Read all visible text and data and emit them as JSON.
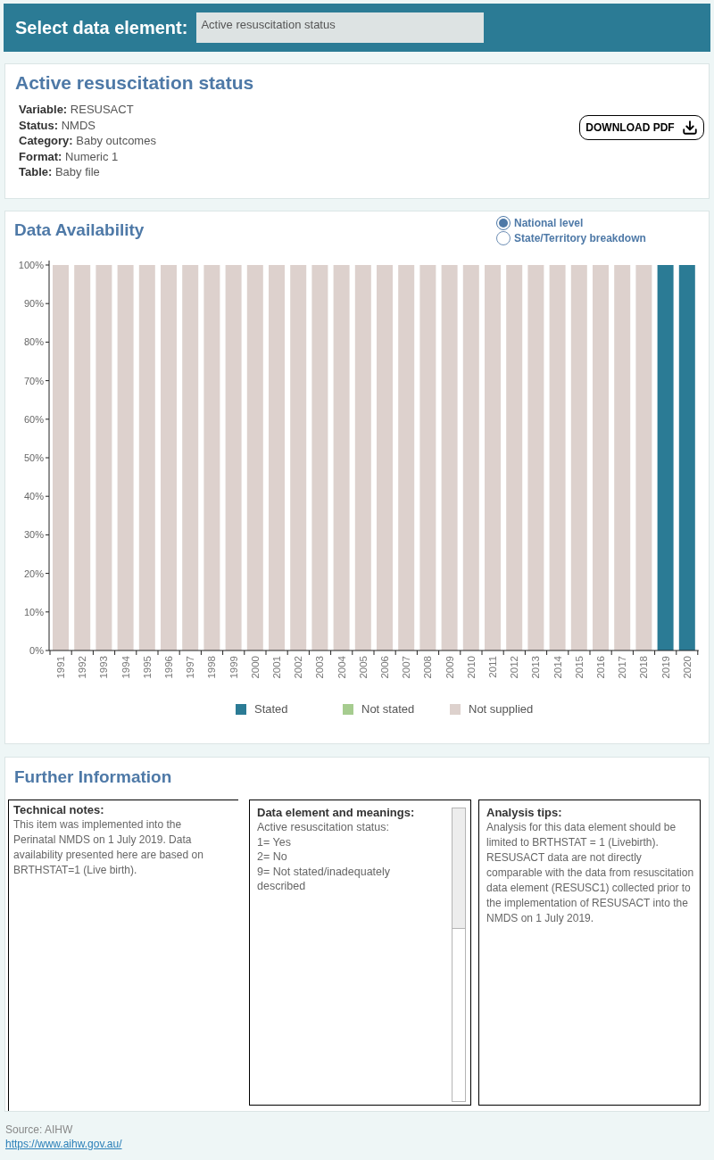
{
  "header": {
    "label": "Select data element:",
    "dropdown": {
      "value": "Active resuscitation status"
    }
  },
  "element": {
    "title": "Active resuscitation status",
    "fields": [
      {
        "label": "Variable:",
        "value": "RESUSACT"
      },
      {
        "label": "Status:",
        "value": "NMDS"
      },
      {
        "label": "Category:",
        "value": "Baby outcomes"
      },
      {
        "label": "Format:",
        "value": "Numeric 1"
      },
      {
        "label": "Table:",
        "value": "Baby file"
      }
    ],
    "download_button": "DOWNLOAD PDF"
  },
  "availability": {
    "title": "Data Availability",
    "view_options": [
      {
        "label": "National level",
        "selected": true
      },
      {
        "label": "State/Territory breakdown",
        "selected": false
      }
    ],
    "chart_data": {
      "type": "bar",
      "stacked": true,
      "orientation": "vertical",
      "categories": [
        "1991",
        "1992",
        "1993",
        "1994",
        "1995",
        "1996",
        "1997",
        "1998",
        "1999",
        "2000",
        "2001",
        "2002",
        "2003",
        "2004",
        "2005",
        "2006",
        "2007",
        "2008",
        "2009",
        "2010",
        "2011",
        "2012",
        "2013",
        "2014",
        "2015",
        "2016",
        "2017",
        "2018",
        "2019",
        "2020"
      ],
      "series": [
        {
          "name": "Stated",
          "color": "#2b7b95",
          "values": [
            0,
            0,
            0,
            0,
            0,
            0,
            0,
            0,
            0,
            0,
            0,
            0,
            0,
            0,
            0,
            0,
            0,
            0,
            0,
            0,
            0,
            0,
            0,
            0,
            0,
            0,
            0,
            0,
            100,
            100
          ]
        },
        {
          "name": "Not stated",
          "color": "#a6cc8f",
          "values": [
            0,
            0,
            0,
            0,
            0,
            0,
            0,
            0,
            0,
            0,
            0,
            0,
            0,
            0,
            0,
            0,
            0,
            0,
            0,
            0,
            0,
            0,
            0,
            0,
            0,
            0,
            0,
            0,
            0,
            0
          ]
        },
        {
          "name": "Not supplied",
          "color": "#ddd1cd",
          "values": [
            100,
            100,
            100,
            100,
            100,
            100,
            100,
            100,
            100,
            100,
            100,
            100,
            100,
            100,
            100,
            100,
            100,
            100,
            100,
            100,
            100,
            100,
            100,
            100,
            100,
            100,
            100,
            100,
            0,
            0
          ]
        }
      ],
      "ylim": [
        0,
        100
      ],
      "yticks": [
        {
          "value": 0,
          "label": "0%"
        },
        {
          "value": 10,
          "label": "10%"
        },
        {
          "value": 20,
          "label": "20%"
        },
        {
          "value": 30,
          "label": "30%"
        },
        {
          "value": 40,
          "label": "40%"
        },
        {
          "value": 50,
          "label": "50%"
        },
        {
          "value": 60,
          "label": "60%"
        },
        {
          "value": 70,
          "label": "70%"
        },
        {
          "value": 80,
          "label": "80%"
        },
        {
          "value": 90,
          "label": "90%"
        },
        {
          "value": 100,
          "label": "100%"
        }
      ]
    }
  },
  "further_information": {
    "title": "Further Information",
    "panels": [
      {
        "kind": "paragraph",
        "heading": "Technical notes:",
        "text": "This item was implemented into the Perinatal NMDS on 1 July 2019. Data availability presented here are based on BRTHSTAT=1 (Live birth)."
      },
      {
        "kind": "list",
        "heading": "Data element and meanings:",
        "lines": [
          "Active resuscitation status:",
          "1= Yes",
          "2= No",
          "9= Not stated/inadequately described"
        ]
      },
      {
        "kind": "paragraph",
        "heading": "Analysis tips:",
        "text": "Analysis for this data element should be limited to BRTHSTAT = 1 (Livebirth). RESUSACT data are not directly comparable with the data from resuscitation data element (RESUSC1) collected prior to the implementation of RESUSACT into the NMDS on 1 July 2019."
      }
    ]
  },
  "footer": {
    "source": "Source: AIHW",
    "link": "https://www.aihw.gov.au/"
  }
}
